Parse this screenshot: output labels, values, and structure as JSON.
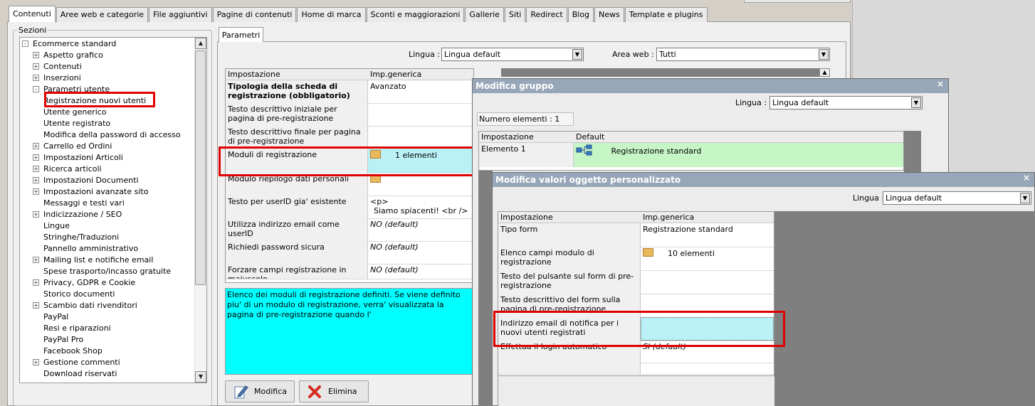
{
  "main_tabs": [
    "Contenuti",
    "Aree web e categorie",
    "File aggiuntivi",
    "Pagine di contenuti",
    "Home di marca",
    "Sconti e maggiorazioni",
    "Gallerie",
    "Siti",
    "Redirect",
    "Blog",
    "News",
    "Template e plugins"
  ],
  "sezioni": {
    "label": "Sezioni",
    "tree": [
      {
        "label": "Ecommerce standard",
        "expander": "-"
      },
      {
        "label": "Aspetto grafico",
        "expander": "+"
      },
      {
        "label": "Contenuti",
        "expander": "+"
      },
      {
        "label": "Inserzioni",
        "expander": "+"
      },
      {
        "label": "Parametri utente",
        "expander": "-"
      },
      {
        "label": "Registrazione nuovi utenti",
        "expander": "",
        "selected": true
      },
      {
        "label": "Utente generico",
        "expander": ""
      },
      {
        "label": "Utente registrato",
        "expander": ""
      },
      {
        "label": "Modifica della password di accesso",
        "expander": ""
      },
      {
        "label": "Carrello ed Ordini",
        "expander": "+"
      },
      {
        "label": "Impostazioni Articoli",
        "expander": "+"
      },
      {
        "label": "Ricerca articoli",
        "expander": "+"
      },
      {
        "label": "Impostazioni Documenti",
        "expander": "+"
      },
      {
        "label": "Impostazioni avanzate sito",
        "expander": "+"
      },
      {
        "label": "Messaggi e testi vari",
        "expander": ""
      },
      {
        "label": "Indicizzazione / SEO",
        "expander": "+"
      },
      {
        "label": "Lingue",
        "expander": ""
      },
      {
        "label": "Stringhe/Traduzioni",
        "expander": ""
      },
      {
        "label": "Pannello amministrativo",
        "expander": ""
      },
      {
        "label": "Mailing list e notifiche email",
        "expander": "+"
      },
      {
        "label": "Spese trasporto/incasso gratuite",
        "expander": ""
      },
      {
        "label": "Privacy, GDPR e Cookie",
        "expander": "+"
      },
      {
        "label": "Storico documenti",
        "expander": ""
      },
      {
        "label": "Scambio dati rivenditori",
        "expander": "+"
      },
      {
        "label": "PayPal",
        "expander": ""
      },
      {
        "label": "Resi e riparazioni",
        "expander": ""
      },
      {
        "label": "PayPal Pro",
        "expander": ""
      },
      {
        "label": "Facebook Shop",
        "expander": ""
      },
      {
        "label": "Gestione commenti",
        "expander": "+"
      },
      {
        "label": "Download riservati",
        "expander": ""
      }
    ]
  },
  "parametri": {
    "tab_label": "Parametri",
    "lingua_label": "Lingua :",
    "lingua_value": "Lingua default",
    "area_label": "Area web :",
    "area_value": "Tutti",
    "col_impostazione": "Impostazione",
    "col_generica": "Imp.generica",
    "rows": [
      {
        "label": "Tipologia della scheda di registrazione (obbligatorio)",
        "value": "Avanzato",
        "bold": true
      },
      {
        "label": "Testo descrittivo iniziale per pagina di pre-registrazione",
        "value": ""
      },
      {
        "label": "Testo descrittivo finale per pagina di pre-registrazione",
        "value": ""
      },
      {
        "label": "Moduli di registrazione",
        "value": "1 elementi",
        "folder": true,
        "highlight": true
      },
      {
        "label": "Modulo riepilogo dati personali",
        "value": "",
        "folder": true
      },
      {
        "label": "Testo per userID gia' esistente",
        "value": "<p>",
        "value2": "Siamo spiacenti! <br />"
      },
      {
        "label": "Utilizza indirizzo email come userID",
        "value": "NO (default)",
        "italic": true
      },
      {
        "label": "Richiedi password sicura",
        "value": "NO (default)",
        "italic": true
      },
      {
        "label": "Forzare campi registrazione in maiuscolo",
        "value": "NO (default)",
        "italic": true
      }
    ],
    "description": "Elenco dei moduli di registrazione definiti. Se viene definito piu' di un modulo di registrazione, verra' visualizzata la pagina di pre-registrazione quando l'",
    "btn_modifica": "Modifica",
    "btn_elimina": "Elimina"
  },
  "dialog_gruppo": {
    "title": "Modifica gruppo",
    "close": "×",
    "lingua_label": "Lingua :",
    "lingua_value": "Lingua default",
    "numero": "Numero elementi : 1",
    "col_impostazione": "Impostazione",
    "col_default": "Default",
    "row_label": "Elemento 1",
    "row_value": "Registrazione standard"
  },
  "dialog_valori": {
    "title": "Modifica valori oggetto personalizzato",
    "close": "×",
    "lingua_label": "Lingua :",
    "lingua_value": "Lingua default",
    "col_impostazione": "Impostazione",
    "col_generica": "Imp.generica",
    "rows": [
      {
        "label": "Tipo form",
        "value": "Registrazione standard"
      },
      {
        "label": "Elenco campi modulo di registrazione",
        "value": "10 elementi",
        "folder": true
      },
      {
        "label": "Testo del pulsante sul form di pre-registrazione",
        "value": ""
      },
      {
        "label": "Testo descrittivo del form sulla pagina di pre-registrazione",
        "value": ""
      },
      {
        "label": "Indirizzo email di notifica per i nuovi utenti registrati",
        "value": "",
        "highlight": true
      },
      {
        "label": "Effettua il login automatico",
        "value": "SI (default)",
        "italic": true
      },
      {
        "label": "",
        "value": ""
      }
    ]
  }
}
